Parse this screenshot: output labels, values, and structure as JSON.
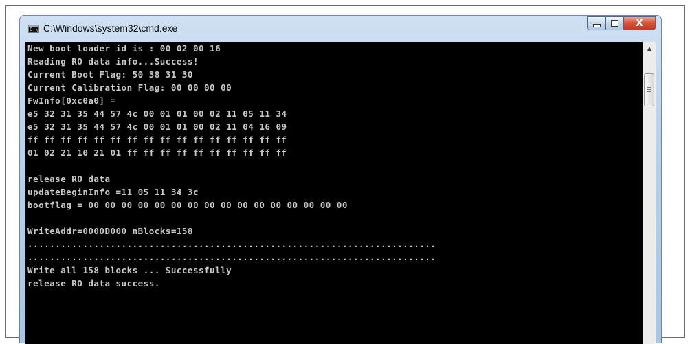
{
  "window": {
    "title": "C:\\Windows\\system32\\cmd.exe",
    "icon": "cmd-icon",
    "controls": {
      "minimize": "minimize-icon",
      "maximize": "maximize-icon",
      "close": "X"
    }
  },
  "console": {
    "lines": [
      "New boot loader id is : 00 02 00 16",
      "Reading RO data info...Success!",
      "Current Boot Flag: 50 38 31 30",
      "Current Calibration Flag: 00 00 00 00",
      "FwInfo[0xc0a0] =",
      "e5 32 31 35 44 57 4c 00 01 01 00 02 11 05 11 34",
      "e5 32 31 35 44 57 4c 00 01 01 00 02 11 04 16 09",
      "ff ff ff ff ff ff ff ff ff ff ff ff ff ff ff ff",
      "01 02 21 10 21 01 ff ff ff ff ff ff ff ff ff ff",
      "",
      "release RO data",
      "updateBeginInfo =11 05 11 34 3c",
      "bootflag = 00 00 00 00 00 00 00 00 00 00 00 00 00 00 00 00",
      "",
      "WriteAddr=0000D000 nBlocks=158",
      "..........................................................................",
      "..........................................................................",
      "Write all 158 blocks ... Successfully",
      "release RO data success."
    ]
  },
  "scrollbar": {
    "up_arrow": "▲"
  }
}
